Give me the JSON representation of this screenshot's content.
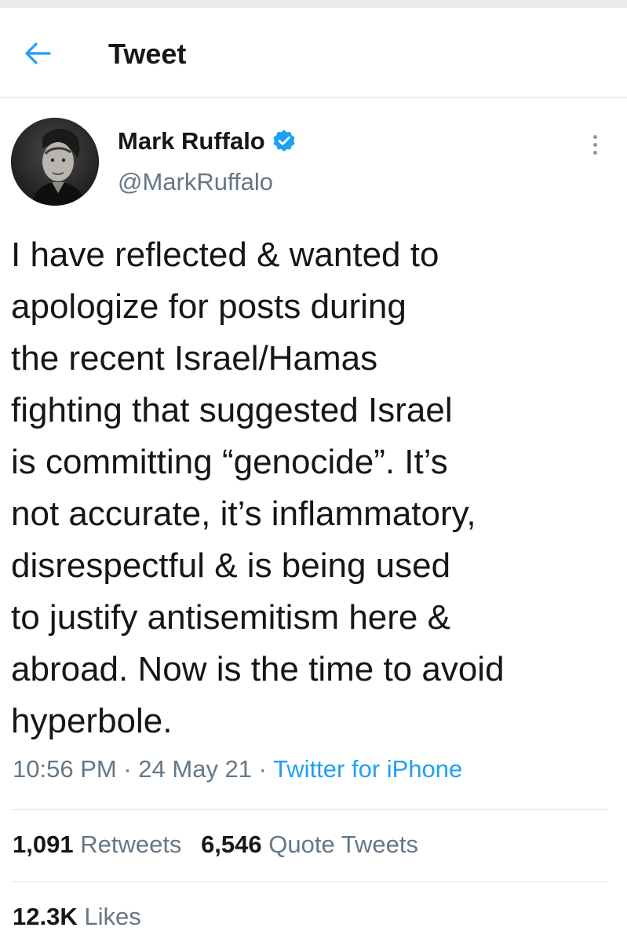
{
  "header": {
    "back_icon": "arrow-left-icon",
    "title": "Tweet"
  },
  "tweet": {
    "author": {
      "name": "Mark Ruffalo",
      "handle": "@MarkRuffalo",
      "verified_icon": "verified-badge-icon",
      "avatar": "avatar-photo"
    },
    "more_icon": "more-vertical-icon",
    "text": "I have reflected & wanted to\napologize for posts during\nthe recent Israel/Hamas\nfighting that suggested Israel\nis committing “genocide”. It’s\nnot accurate, it’s inflammatory,\ndisrespectful & is being used\nto justify antisemitism here &\nabroad. Now is the time to avoid\nhyperbole.",
    "time": "10:56 PM",
    "date": "24 May 21",
    "separator": "·",
    "source": "Twitter for iPhone",
    "stats": {
      "retweets_count": "1,091",
      "retweets_label": "Retweets",
      "quotes_count": "6,546",
      "quotes_label": "Quote Tweets",
      "likes_count": "12.3K",
      "likes_label": "Likes"
    }
  },
  "colors": {
    "accent": "#1da1f2",
    "secondary_text": "#657786",
    "primary_text": "#14171a"
  }
}
